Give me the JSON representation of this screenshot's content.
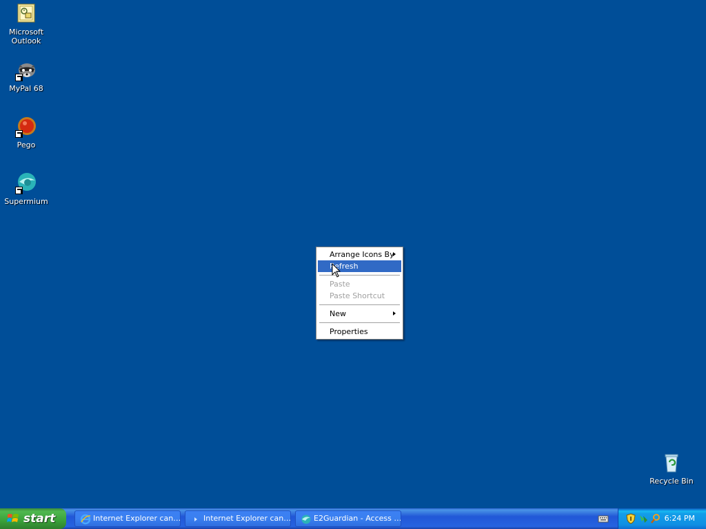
{
  "desktop": {
    "background_color": "#004e98",
    "icons": [
      {
        "label_line1": "Microsoft",
        "label_line2": "Outlook",
        "icon": "outlook-icon"
      },
      {
        "label_line1": "MyPal 68",
        "icon": "mypal-icon"
      },
      {
        "label_line1": "Pego",
        "icon": "pego-icon"
      },
      {
        "label_line1": "Supermium",
        "icon": "supermium-icon"
      },
      {
        "label_line1": "Recycle Bin",
        "icon": "recycle-bin-icon"
      }
    ]
  },
  "context_menu": {
    "items": [
      {
        "label": "Arrange Icons By",
        "submenu": true,
        "state": "normal"
      },
      {
        "label": "Refresh",
        "submenu": false,
        "state": "selected"
      },
      {
        "label": "Paste",
        "submenu": false,
        "state": "disabled"
      },
      {
        "label": "Paste Shortcut",
        "submenu": false,
        "state": "disabled"
      },
      {
        "label": "New",
        "submenu": true,
        "state": "normal"
      },
      {
        "label": "Properties",
        "submenu": false,
        "state": "normal"
      }
    ],
    "highlight_color": "#316ac5"
  },
  "taskbar": {
    "start_label": "start",
    "tasks": [
      {
        "label": "Internet Explorer can…",
        "icon": "internet-explorer-icon"
      },
      {
        "label": "Internet Explorer can…",
        "icon": "window-icon"
      },
      {
        "label": "E2Guardian - Access …",
        "icon": "supermium-icon"
      }
    ],
    "tray": {
      "clock": "6:24 PM",
      "icons": [
        "keyboard-icon",
        "security-shield-icon",
        "network-icon",
        "search-icon"
      ]
    }
  }
}
